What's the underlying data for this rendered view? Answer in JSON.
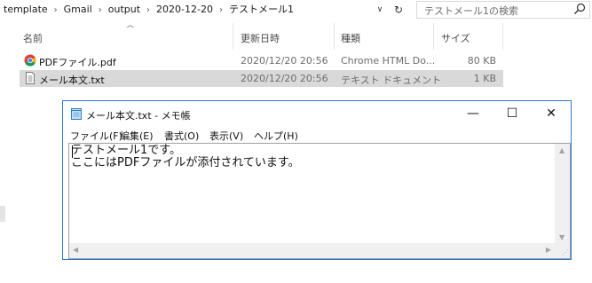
{
  "address_bar": {
    "breadcrumbs": [
      "template",
      "Gmail",
      "output",
      "2020-12-20",
      "テストメール1"
    ],
    "separator": "›",
    "dropdown_glyph": "∨",
    "refresh_glyph": "↻"
  },
  "search": {
    "placeholder": "テストメール1の検索"
  },
  "file_list": {
    "columns": {
      "name": "名前",
      "modified": "更新日時",
      "type": "種類",
      "size": "サイズ"
    },
    "sort_glyph": "^",
    "rows": [
      {
        "name": "PDFファイル.pdf",
        "modified": "2020/12/20 20:56",
        "type": "Chrome HTML Do...",
        "size": "80 KB",
        "icon": "chrome-icon",
        "selected": false
      },
      {
        "name": "メール本文.txt",
        "modified": "2020/12/20 20:56",
        "type": "テキスト ドキュメント",
        "size": "1 KB",
        "icon": "text-file-icon",
        "selected": true
      }
    ]
  },
  "notepad": {
    "title": "メール本文.txt - メモ帳",
    "controls": {
      "minimize": "—",
      "maximize": "☐",
      "close": "✕"
    },
    "menu": [
      "ファイル(F)",
      "編集(E)",
      "書式(O)",
      "表示(V)",
      "ヘルプ(H)"
    ],
    "content_lines": [
      "テストメール1です。",
      "ここにはPDFファイルが添付されています。"
    ]
  },
  "colors": {
    "accent": "#2b79d6",
    "selection": "#d9d9d9"
  }
}
